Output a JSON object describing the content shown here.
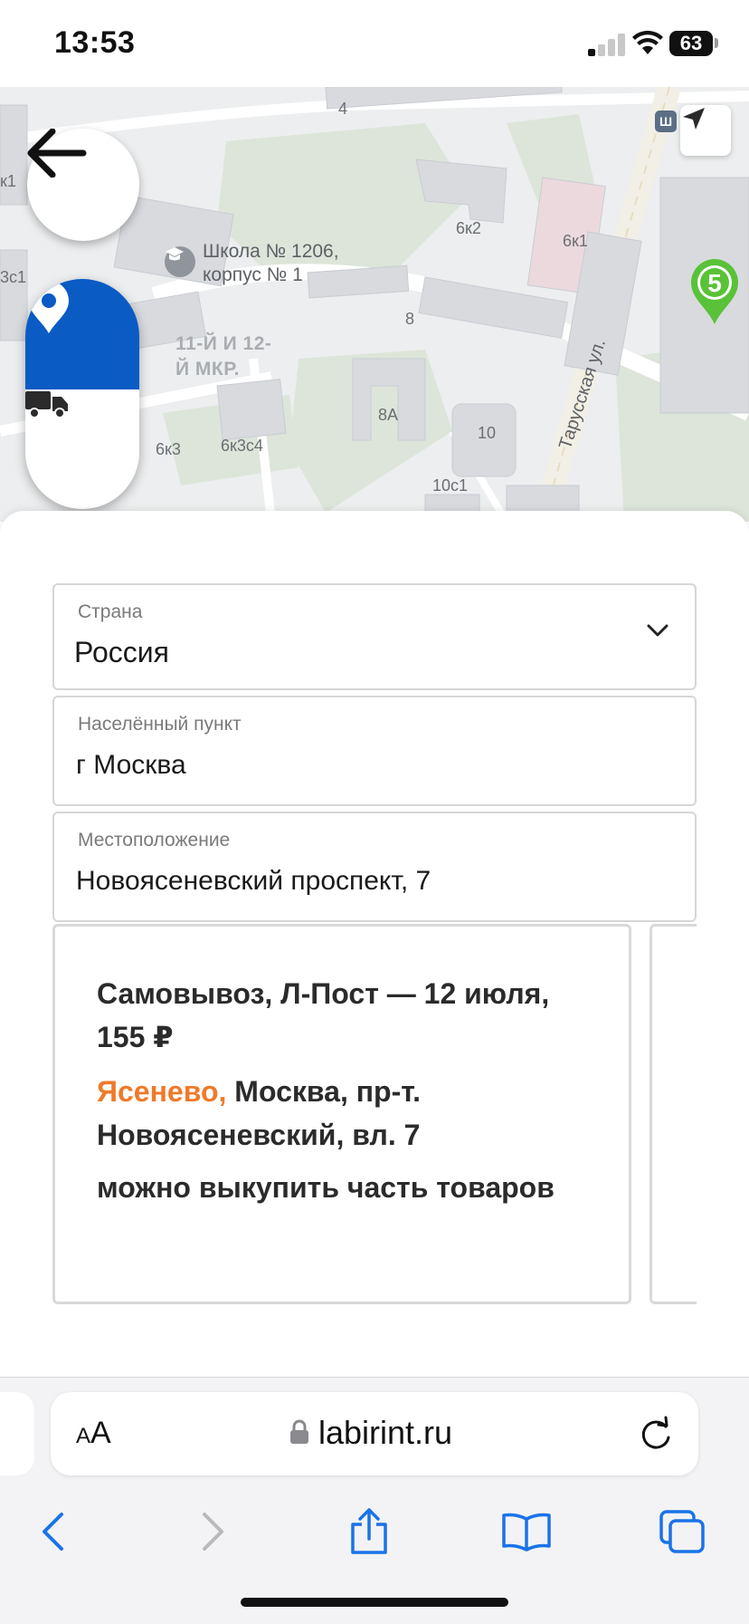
{
  "status_bar": {
    "time": "13:53",
    "battery": "63"
  },
  "map": {
    "labels": {
      "house_4": "4",
      "house_6k2": "6к2",
      "house_6k1": "6к1",
      "school_line1": "Школа № 1206,",
      "school_line2": "корпус № 1",
      "area_line1": "11-Й И 12-",
      "area_line2": "Й МКР.",
      "house_8": "8",
      "house_8a": "8А",
      "house_10": "10",
      "house_10c1": "10с1",
      "house_6k3": "6к3",
      "house_6k3c4": "6к3с4",
      "house_k1_a": "к1",
      "house_c1_b": "3с1",
      "street_tarusskaya": "Тарусская ул.",
      "pin_number": "5"
    },
    "colors": {
      "pickup_blue": "#0a5bc4",
      "pin_green": "#59c238"
    }
  },
  "form": {
    "country": {
      "label": "Страна",
      "value": "Россия"
    },
    "city": {
      "label": "Населённый пункт",
      "value": "г Москва"
    },
    "location": {
      "label": "Местоположение",
      "value": "Новоясеневский проспект, 7"
    }
  },
  "pickup_card": {
    "title": "Самовывоз, Л-Пост — 12 июля, 155 ₽",
    "district": "Ясенево,",
    "address": " Москва, пр-т. Новоясеневский, вл. 7",
    "note": "можно выкупить часть товаров",
    "district_color": "#ef7a2a"
  },
  "browser": {
    "aa_small": "A",
    "aa_large": "A",
    "url": "labirint.ru"
  }
}
